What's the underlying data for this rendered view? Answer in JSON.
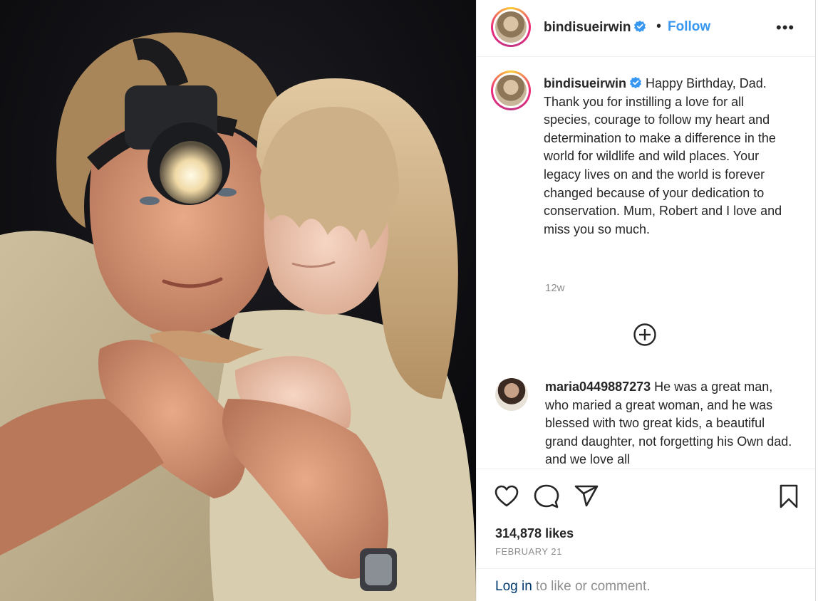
{
  "header": {
    "username": "bindisueirwin",
    "separator": "•",
    "follow_label": "Follow",
    "more_label": "•••"
  },
  "caption": {
    "username": "bindisueirwin",
    "text": "Happy Birthday, Dad.\nThank you for instilling a love for all species, courage to follow my heart and determination to make a difference in the world for wildlife and wild places. Your legacy lives on and the world is forever changed because of your dedication to conservation. Mum, Robert and I love and miss you so much.",
    "time": "12w"
  },
  "load_more_icon": "plus-circle-icon",
  "comment": {
    "username": "maria0449887273",
    "text": "He was a great man, who maried a great woman, and he was blessed with two great kids, a beautiful grand daughter, not forgetting his Own dad. and we love all"
  },
  "actions": {
    "icons": [
      "heart-icon",
      "comment-icon",
      "share-icon",
      "bookmark-icon"
    ],
    "likes": "314,878 likes",
    "date": "FEBRUARY 21"
  },
  "login": {
    "link_text": "Log in",
    "rest_text": " to like or comment."
  },
  "colors": {
    "follow": "#3897f0",
    "verified": "#3897f0",
    "secondary_text": "#8e8e8e",
    "link": "#00376b"
  }
}
